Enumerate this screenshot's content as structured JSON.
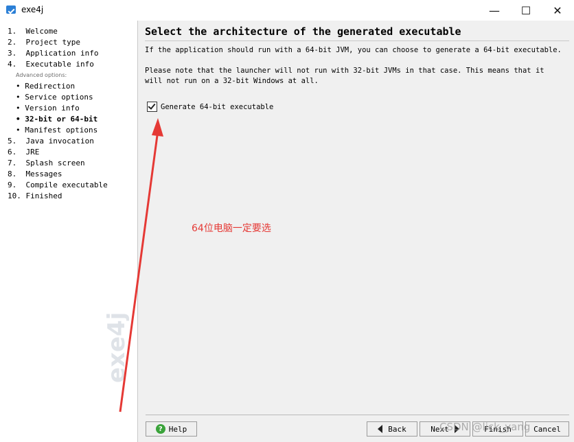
{
  "window": {
    "title": "exe4j"
  },
  "sidebar": {
    "items": [
      {
        "label": "1.  Welcome"
      },
      {
        "label": "2.  Project type"
      },
      {
        "label": "3.  Application info"
      },
      {
        "label": "4.  Executable info"
      }
    ],
    "advanced_label": "Advanced options:",
    "advanced_items": [
      {
        "label": "• Redirection"
      },
      {
        "label": "• Service options"
      },
      {
        "label": "• Version info"
      },
      {
        "label": "• 32-bit or 64-bit"
      },
      {
        "label": "• Manifest options"
      }
    ],
    "items_after": [
      {
        "label": "5.  Java invocation"
      },
      {
        "label": "6.  JRE"
      },
      {
        "label": "7.  Splash screen"
      },
      {
        "label": "8.  Messages"
      },
      {
        "label": "9.  Compile executable"
      },
      {
        "label": "10. Finished"
      }
    ],
    "logo_text": "exe4j"
  },
  "main": {
    "title": "Select the architecture of the generated executable",
    "para1": "If the application should run with a 64-bit JVM, you can choose to generate a 64-bit executable.",
    "para2": "Please note that the launcher will not run with 32-bit JVMs in that case. This means that it will not run on a 32-bit Windows at all.",
    "checkbox_label": "Generate 64-bit executable",
    "checkbox_checked": true
  },
  "annotation": {
    "text": "64位电脑一定要选",
    "color": "#e53935"
  },
  "buttons": {
    "help": "Help",
    "back": "Back",
    "next": "Next",
    "finish": "Finish",
    "cancel": "Cancel"
  },
  "watermark": "CSDN @lick_yang"
}
